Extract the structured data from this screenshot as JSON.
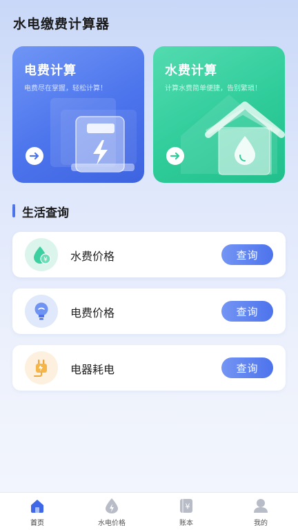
{
  "app_title": "水电缴费计算器",
  "cards": {
    "electric": {
      "title": "电费计算",
      "subtitle": "电费尽在掌握，轻松计算！"
    },
    "water": {
      "title": "水费计算",
      "subtitle": "计算水费简单便捷，告别繁琐！"
    }
  },
  "section": {
    "title": "生活查询"
  },
  "rows": [
    {
      "label": "水费价格",
      "button": "查询",
      "icon": "water-drop-yuan-icon"
    },
    {
      "label": "电费价格",
      "button": "查询",
      "icon": "lightbulb-icon"
    },
    {
      "label": "电器耗电",
      "button": "查询",
      "icon": "plug-icon"
    }
  ],
  "tabs": [
    {
      "label": "首页",
      "icon": "home-icon",
      "active": true
    },
    {
      "label": "水电价格",
      "icon": "drop-bolt-icon",
      "active": false
    },
    {
      "label": "账本",
      "icon": "ledger-yuan-icon",
      "active": false
    },
    {
      "label": "我的",
      "icon": "user-icon",
      "active": false
    }
  ],
  "colors": {
    "accent": "#4d73ec",
    "electric_card": "#4c74ec",
    "water_card": "#2fcc9a"
  }
}
